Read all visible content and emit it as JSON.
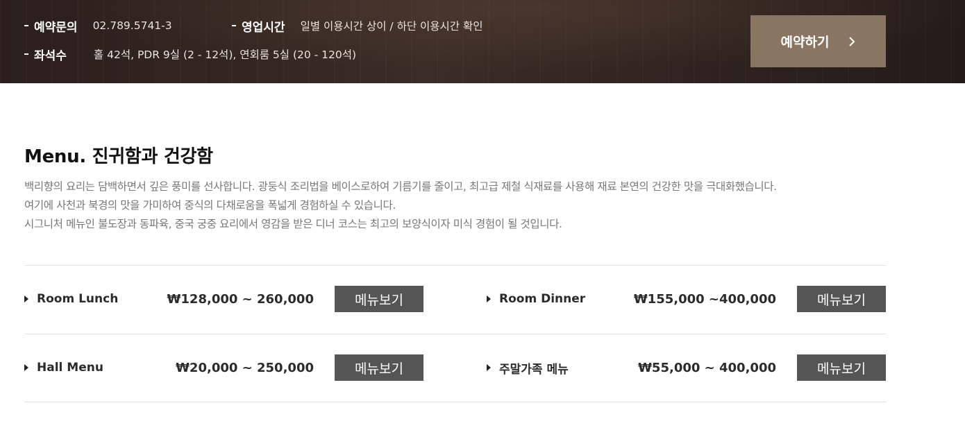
{
  "info": {
    "reservation_label": "예약문의",
    "reservation_value": "02.789.5741-3",
    "hours_label": "영업시간",
    "hours_value": "일별 이용시간 상이 / 하단 이용시간 확인",
    "seats_label": "좌석수",
    "seats_value": "홀 42석, PDR 9실 (2 - 12석), 연회룸 5실 (20 - 120석)",
    "reserve_button": "예약하기"
  },
  "menu": {
    "title_en": "Menu.",
    "title_ko": "진귀함과 건강함",
    "description": [
      "백리향의 요리는 담백하면서 깊은 풍미를 선사합니다. 광둥식 조리법을 베이스로하여 기름기를 줄이고, 최고급 제철 식재료를 사용해 재료 본연의 건강한 맛을 극대화했습니다.",
      "여기에 사천과 북경의 맛을 가미하여 중식의 다채로움을 폭넓게 경험하실 수 있습니다.",
      "시그니처 메뉴인 불도장과 동파육, 중국 궁중 요리에서 영감을 받은 디너 코스는 최고의 보양식이자 미식 경험이 될 것입니다."
    ],
    "items": [
      {
        "name": "Room Lunch",
        "price": "₩128,000 ~ 260,000",
        "button": "메뉴보기"
      },
      {
        "name": "Room Dinner",
        "price": "₩155,000 ~400,000",
        "button": "메뉴보기"
      },
      {
        "name": "Hall Menu",
        "price": "₩20,000 ~ 250,000",
        "button": "메뉴보기"
      },
      {
        "name": "주말가족 메뉴",
        "price": "₩55,000 ~ 400,000",
        "button": "메뉴보기"
      }
    ]
  },
  "colors": {
    "header_bg": "#2e231f",
    "reserve_button_bg": "#8a7563",
    "menu_button_bg": "#555555"
  },
  "icons": {
    "reserve_arrow": "chevron-right-icon",
    "bullet": "triangle-right-icon"
  }
}
